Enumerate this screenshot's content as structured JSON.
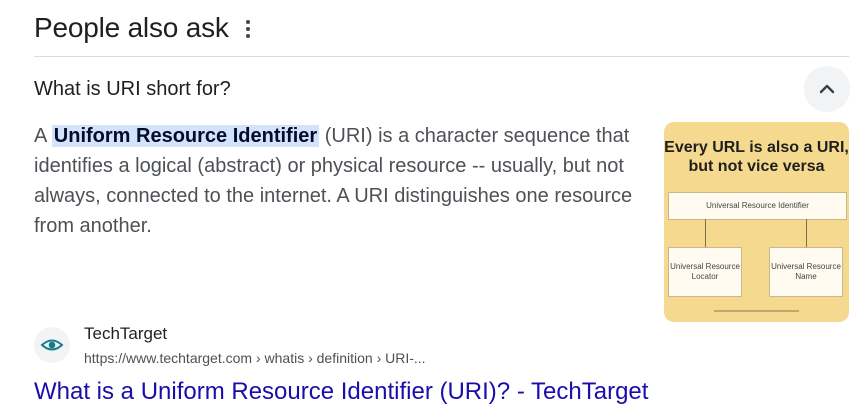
{
  "section": {
    "title": "People also ask"
  },
  "question": {
    "text": "What is URI short for?"
  },
  "answer": {
    "prefix": "A ",
    "highlight": "Uniform Resource Identifier",
    "suffix": " (URI) is a character sequence that identifies a logical (abstract) or physical resource -- usually, but not always, connected to the internet. A URI distinguishes one resource from another."
  },
  "thumbnail": {
    "heading_line1": "Every URL is also a URI,",
    "heading_line2": "but not vice versa",
    "top_box": "Universal Resource Identifier",
    "left_box": "Universal Resource Locator",
    "right_box": "Universal Resource Name"
  },
  "source": {
    "name": "TechTarget",
    "url": "https://www.techtarget.com › whatis › definition › URI-..."
  },
  "result": {
    "title": "What is a Uniform Resource Identifier (URI)? - TechTarget"
  },
  "colors": {
    "link": "#1a0dab",
    "highlight_bg": "#d3e3fd",
    "thumb_bg": "#f5d98e",
    "logo_teal": "#1b7a8a"
  }
}
